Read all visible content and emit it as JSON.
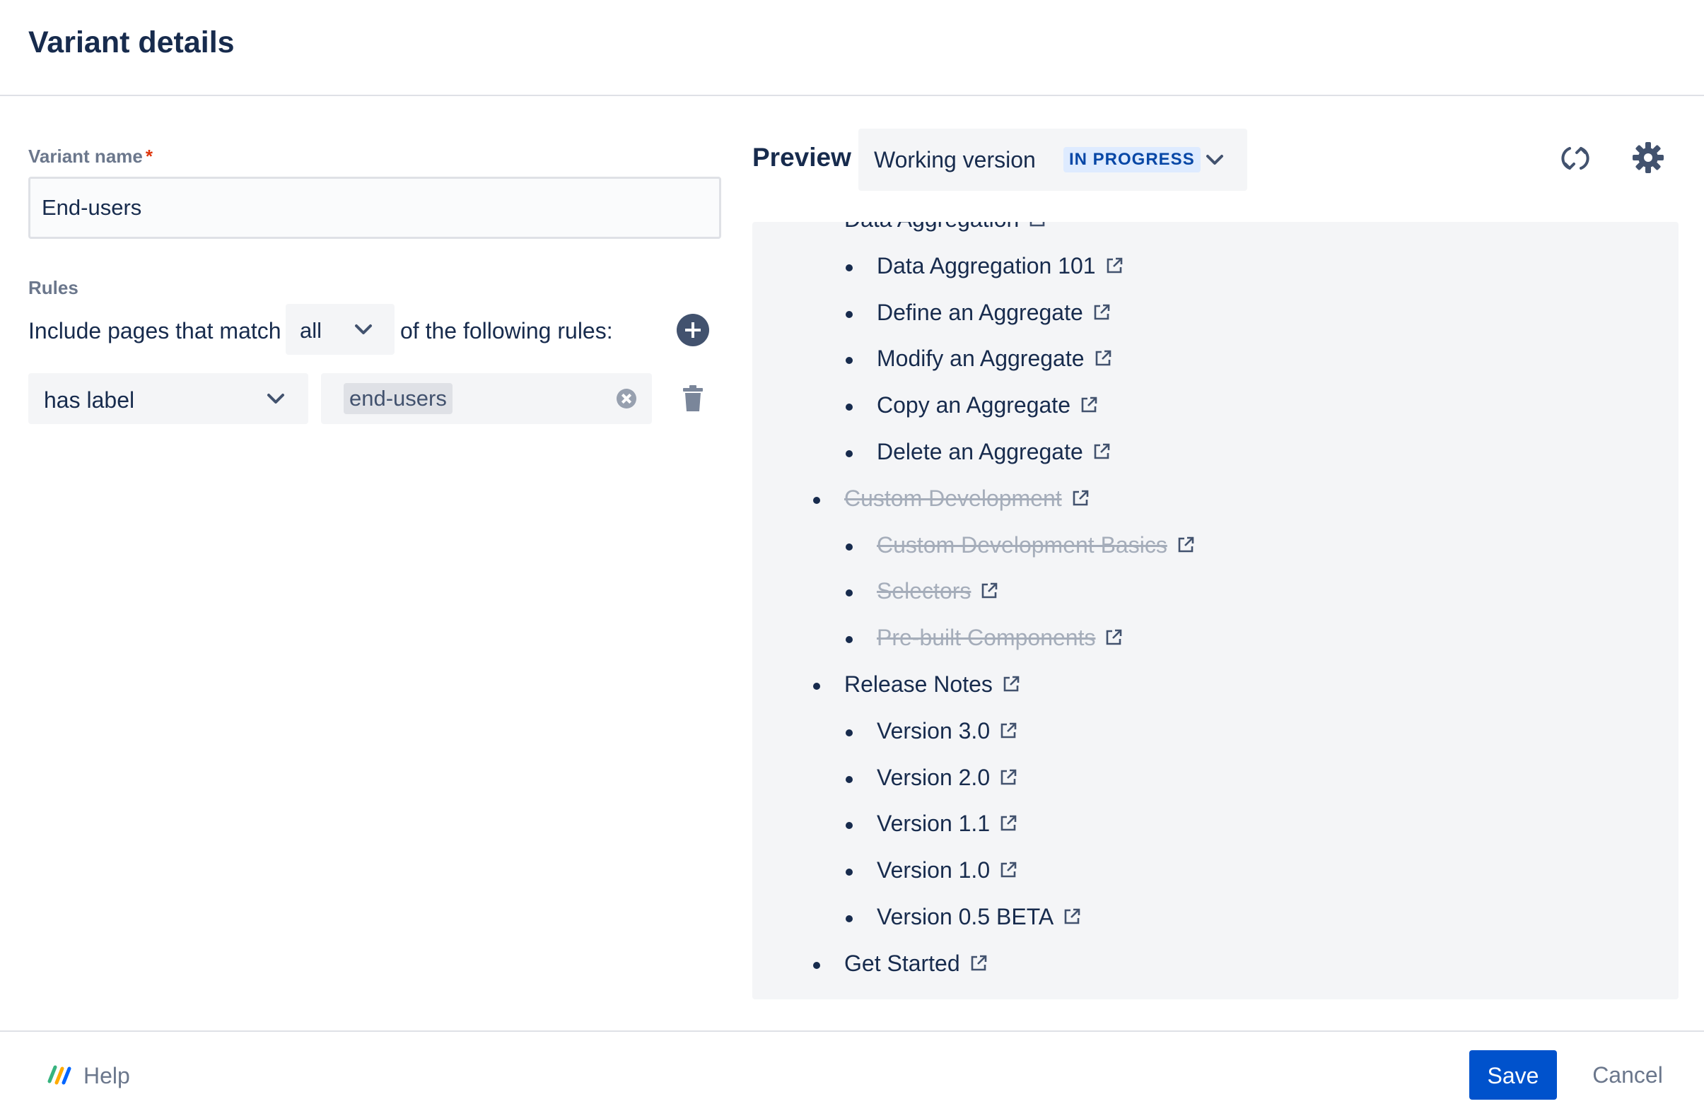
{
  "dialog": {
    "title": "Variant details"
  },
  "form": {
    "variant_name_label": "Variant name",
    "required_marker": "*",
    "variant_name_value": "End-users",
    "rules_label": "Rules",
    "include_prefix": "Include pages that match",
    "match_value": "all",
    "include_suffix": "of the following rules:",
    "rule": {
      "condition": "has label",
      "value_tag": "end-users"
    }
  },
  "preview": {
    "title": "Preview",
    "version_select": "Working version",
    "status_badge": "IN PROGRESS",
    "tree": [
      {
        "label": "Data Aggregation",
        "level": 1,
        "struck": false,
        "clipped": true
      },
      {
        "label": "Data Aggregation 101",
        "level": 2,
        "struck": false
      },
      {
        "label": "Define an Aggregate",
        "level": 2,
        "struck": false
      },
      {
        "label": "Modify an Aggregate",
        "level": 2,
        "struck": false
      },
      {
        "label": "Copy an Aggregate",
        "level": 2,
        "struck": false
      },
      {
        "label": "Delete an Aggregate",
        "level": 2,
        "struck": false
      },
      {
        "label": "Custom Development",
        "level": 1,
        "struck": true
      },
      {
        "label": "Custom Development Basics",
        "level": 2,
        "struck": true
      },
      {
        "label": "Selectors",
        "level": 2,
        "struck": true
      },
      {
        "label": "Pre-built Components",
        "level": 2,
        "struck": true
      },
      {
        "label": "Release Notes",
        "level": 1,
        "struck": false
      },
      {
        "label": "Version 3.0",
        "level": 2,
        "struck": false
      },
      {
        "label": "Version 2.0",
        "level": 2,
        "struck": false
      },
      {
        "label": "Version 1.1",
        "level": 2,
        "struck": false
      },
      {
        "label": "Version 1.0",
        "level": 2,
        "struck": false
      },
      {
        "label": "Version 0.5 BETA",
        "level": 2,
        "struck": false
      },
      {
        "label": "Get Started",
        "level": 1,
        "struck": false
      }
    ]
  },
  "footer": {
    "help_label": "Help",
    "save_label": "Save",
    "cancel_label": "Cancel"
  },
  "icons": {
    "match_dropdown": "chevron-down-icon",
    "add_rule": "plus-circle-icon",
    "clear_tag": "clear-icon",
    "delete_rule": "trash-icon",
    "refresh": "refresh-icon",
    "settings": "gear-icon",
    "external_link": "external-link-icon",
    "help_logo": "help-logo-icon"
  },
  "colors": {
    "primary": "#0052cc",
    "text": "#172b4d",
    "muted": "#6b778c",
    "required": "#de350b",
    "badge_bg": "#deebff",
    "badge_text": "#0747a6",
    "panel_bg": "#f4f5f7"
  }
}
